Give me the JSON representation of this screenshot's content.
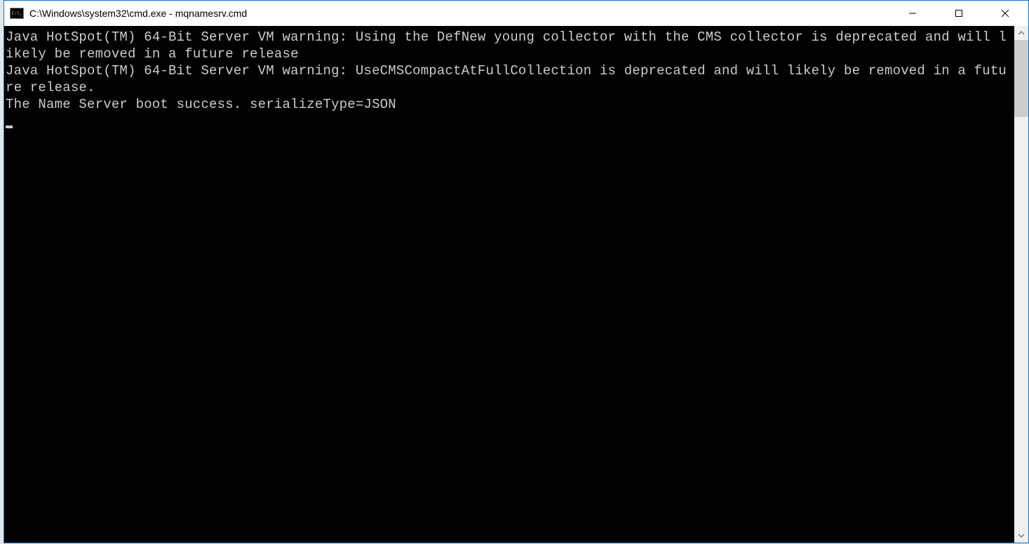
{
  "window": {
    "title": "C:\\Windows\\system32\\cmd.exe - mqnamesrv.cmd",
    "icon_label": "C:\\."
  },
  "terminal": {
    "lines": [
      "Java HotSpot(TM) 64-Bit Server VM warning: Using the DefNew young collector with the CMS collector is deprecated and will likely be removed in a future release",
      "Java HotSpot(TM) 64-Bit Server VM warning: UseCMSCompactAtFullCollection is deprecated and will likely be removed in a future release.",
      "The Name Server boot success. serializeType=JSON"
    ]
  }
}
